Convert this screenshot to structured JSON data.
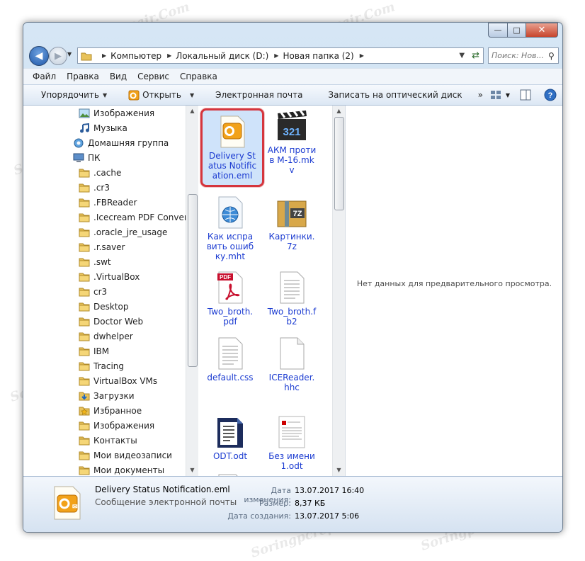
{
  "window": {
    "minimize_glyph": "—",
    "maximize_glyph": "□",
    "close_glyph": "✕"
  },
  "address": {
    "crumbs": [
      "Компьютер",
      "Локальный диск (D:)",
      "Новая папка (2)"
    ],
    "refresh_glyph": "⇄"
  },
  "search": {
    "placeholder": "Поиск: Нов..."
  },
  "menu": [
    "Файл",
    "Правка",
    "Вид",
    "Сервис",
    "Справка"
  ],
  "toolbar": {
    "organize": "Упорядочить",
    "open": "Открыть",
    "email": "Электронная почта",
    "burn": "Записать на оптический диск",
    "more": "»"
  },
  "nav": [
    {
      "label": "Изображения",
      "icon": "pictures-icon"
    },
    {
      "label": "Музыка",
      "icon": "music-icon"
    },
    {
      "label": "Домашняя группа",
      "icon": "homegroup-icon"
    },
    {
      "label": "ПК",
      "icon": "computer-icon"
    },
    {
      "label": ".cache",
      "icon": "folder-icon"
    },
    {
      "label": ".cr3",
      "icon": "folder-icon"
    },
    {
      "label": ".FBReader",
      "icon": "folder-icon"
    },
    {
      "label": ".Icecream PDF Converter",
      "icon": "folder-icon"
    },
    {
      "label": ".oracle_jre_usage",
      "icon": "folder-icon"
    },
    {
      "label": ".r.saver",
      "icon": "folder-icon"
    },
    {
      "label": ".swt",
      "icon": "folder-icon"
    },
    {
      "label": ".VirtualBox",
      "icon": "folder-icon"
    },
    {
      "label": "cr3",
      "icon": "folder-icon"
    },
    {
      "label": "Desktop",
      "icon": "folder-icon"
    },
    {
      "label": "Doctor Web",
      "icon": "folder-icon"
    },
    {
      "label": "dwhelper",
      "icon": "folder-icon"
    },
    {
      "label": "IBM",
      "icon": "folder-icon"
    },
    {
      "label": "Tracing",
      "icon": "folder-icon"
    },
    {
      "label": "VirtualBox VMs",
      "icon": "folder-icon"
    },
    {
      "label": "Загрузки",
      "icon": "downloads-icon"
    },
    {
      "label": "Избранное",
      "icon": "favorites-icon"
    },
    {
      "label": "Изображения",
      "icon": "folder-icon"
    },
    {
      "label": "Контакты",
      "icon": "folder-icon"
    },
    {
      "label": "Мои видеозаписи",
      "icon": "folder-icon"
    },
    {
      "label": "Мои документы",
      "icon": "folder-icon"
    }
  ],
  "files": [
    {
      "label": "Delivery Status Notification.eml",
      "icon": "outlook-eml-icon",
      "selected": true
    },
    {
      "label": "АКМ против М-16.mkv",
      "icon": "video-clapper-icon"
    },
    {
      "label": "Как исправить ошибку.mht",
      "icon": "web-document-icon"
    },
    {
      "label": "Картинки.7z",
      "icon": "archive-7z-icon"
    },
    {
      "label": "Two_broth.pdf",
      "icon": "pdf-icon"
    },
    {
      "label": "Two_broth.fb2",
      "icon": "text-document-icon"
    },
    {
      "label": "default.css",
      "icon": "text-document-icon"
    },
    {
      "label": "ICEReader.hhc",
      "icon": "blank-document-icon"
    },
    {
      "label": "ODT.odt",
      "icon": "odt-document-icon"
    },
    {
      "label": "Без имени 1.odt",
      "icon": "document-thumbnail-icon"
    },
    {
      "label": "",
      "icon": "word-document-icon"
    },
    {
      "label": "",
      "icon": "peach-image-icon"
    }
  ],
  "preview_text": "Нет данных для предварительного просмотра.",
  "details": {
    "name": "Delivery Status Notification.eml",
    "type": "Сообщение электронной почты",
    "modified_label": "Дата изменения:",
    "modified": "13.07.2017 16:40",
    "size_label": "Размер:",
    "size": "8,37 КБ",
    "created_label": "Дата создания:",
    "created": "13.07.2017 5:06"
  },
  "watermark": "Soringpcrepair.Com",
  "colors": {
    "accent_selection": "#cfe3fa",
    "highlight_outline": "#d5353d",
    "link_text": "#1b3bd1"
  }
}
